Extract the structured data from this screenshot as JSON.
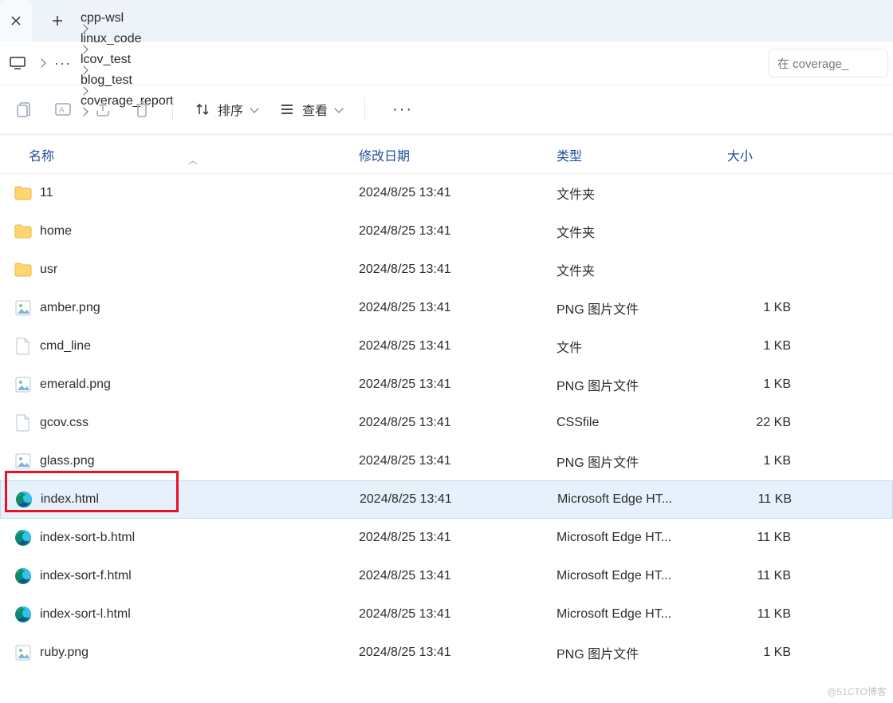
{
  "tabs": {
    "close_label": "×",
    "new_label": "+"
  },
  "breadcrumbs": [
    "cpp-wsl",
    "linux_code",
    "lcov_test",
    "blog_test",
    "coverage_report"
  ],
  "search_placeholder": "在 coverage_",
  "toolbar": {
    "sort": "排序",
    "view": "查看",
    "more": "···"
  },
  "columns": {
    "name": "名称",
    "date": "修改日期",
    "type": "类型",
    "size": "大小"
  },
  "files": [
    {
      "icon": "folder",
      "name": "11",
      "date": "2024/8/25 13:41",
      "type": "文件夹",
      "size": ""
    },
    {
      "icon": "folder",
      "name": "home",
      "date": "2024/8/25 13:41",
      "type": "文件夹",
      "size": ""
    },
    {
      "icon": "folder",
      "name": "usr",
      "date": "2024/8/25 13:41",
      "type": "文件夹",
      "size": ""
    },
    {
      "icon": "png",
      "name": "amber.png",
      "date": "2024/8/25 13:41",
      "type": "PNG 图片文件",
      "size": "1 KB"
    },
    {
      "icon": "file",
      "name": "cmd_line",
      "date": "2024/8/25 13:41",
      "type": "文件",
      "size": "1 KB"
    },
    {
      "icon": "png",
      "name": "emerald.png",
      "date": "2024/8/25 13:41",
      "type": "PNG 图片文件",
      "size": "1 KB"
    },
    {
      "icon": "file",
      "name": "gcov.css",
      "date": "2024/8/25 13:41",
      "type": "CSSfile",
      "size": "22 KB"
    },
    {
      "icon": "png",
      "name": "glass.png",
      "date": "2024/8/25 13:41",
      "type": "PNG 图片文件",
      "size": "1 KB"
    },
    {
      "icon": "edge",
      "name": "index.html",
      "date": "2024/8/25 13:41",
      "type": "Microsoft Edge HT...",
      "size": "11 KB",
      "selected": true,
      "highlight": true
    },
    {
      "icon": "edge",
      "name": "index-sort-b.html",
      "date": "2024/8/25 13:41",
      "type": "Microsoft Edge HT...",
      "size": "11 KB"
    },
    {
      "icon": "edge",
      "name": "index-sort-f.html",
      "date": "2024/8/25 13:41",
      "type": "Microsoft Edge HT...",
      "size": "11 KB"
    },
    {
      "icon": "edge",
      "name": "index-sort-l.html",
      "date": "2024/8/25 13:41",
      "type": "Microsoft Edge HT...",
      "size": "11 KB"
    },
    {
      "icon": "png",
      "name": "ruby.png",
      "date": "2024/8/25 13:41",
      "type": "PNG 图片文件",
      "size": "1 KB"
    }
  ],
  "watermark": "@51CTO博客"
}
